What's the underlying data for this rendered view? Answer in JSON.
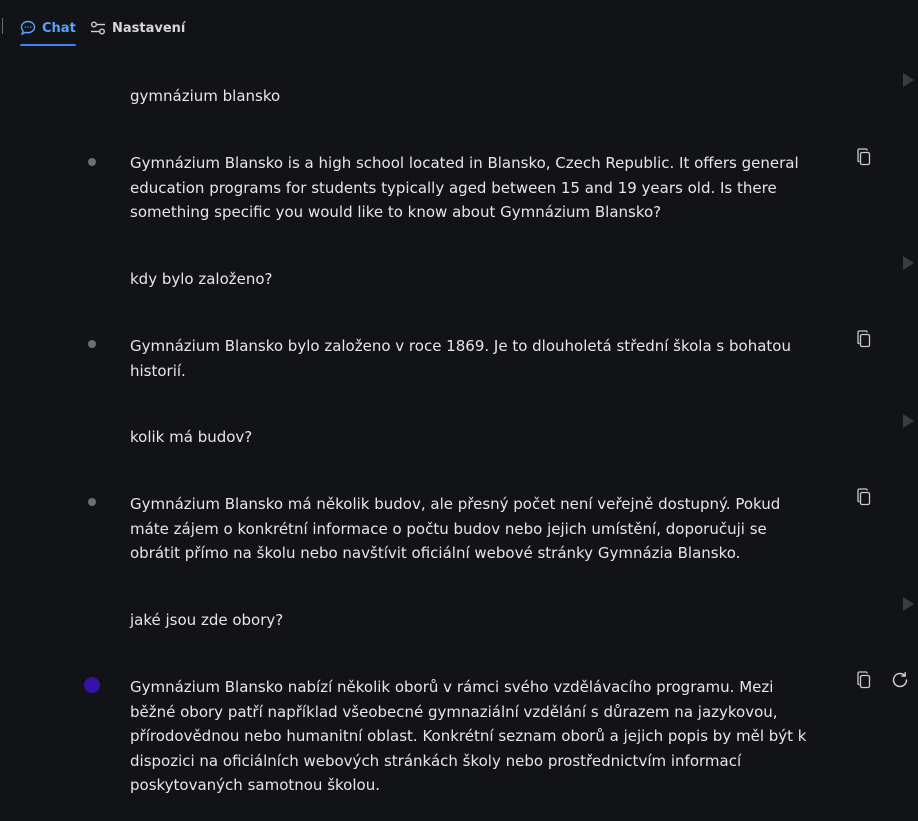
{
  "tabs": {
    "chat": "Chat",
    "settings": "Nastavení"
  },
  "messages": [
    {
      "role": "user",
      "text": "gymnázium blansko"
    },
    {
      "role": "assistant",
      "text": "Gymnázium Blansko is a high school located in Blansko, Czech Republic. It offers general education programs for students typically aged between 15 and 19 years old. Is there something specific you would like to know about Gymnázium Blansko?"
    },
    {
      "role": "user",
      "text": "kdy bylo založeno?"
    },
    {
      "role": "assistant",
      "text": "Gymnázium Blansko bylo založeno v roce 1869. Je to dlouholetá střední škola s bohatou historií."
    },
    {
      "role": "user",
      "text": "kolik má budov?"
    },
    {
      "role": "assistant",
      "text": "Gymnázium Blansko má několik budov, ale přesný počet není veřejně dostupný. Pokud máte zájem o konkrétní informace o počtu budov nebo jejich umístění, doporučuji se obrátit přímo na školu nebo navštívit oficiální webové stránky Gymnázia Blansko."
    },
    {
      "role": "user",
      "text": "jaké jsou zde obory?"
    },
    {
      "role": "assistant",
      "text": "Gymnázium Blansko nabízí několik oborů v rámci svého vzdělávacího programu. Mezi běžné obory patří například všeobecné gymnaziální vzdělání s důrazem na jazykovou, přírodovědnou nebo humanitní oblast. Konkrétní seznam oborů a jejich popis by měl být k dispozici na oficiálních webových stránkách školy nebo prostřednictvím informací poskytovaných samotnou školou."
    }
  ],
  "icons": {
    "chat_tab": "chat-bubble-icon",
    "settings_tab": "sliders-icon",
    "assistant_marker": "dot-icon",
    "copy": "copy-icon",
    "regenerate": "refresh-icon",
    "user_flag": "flag-icon"
  },
  "colors": {
    "background": "#121316",
    "accent": "#3b82f6",
    "active_dot": "#3511a8"
  }
}
